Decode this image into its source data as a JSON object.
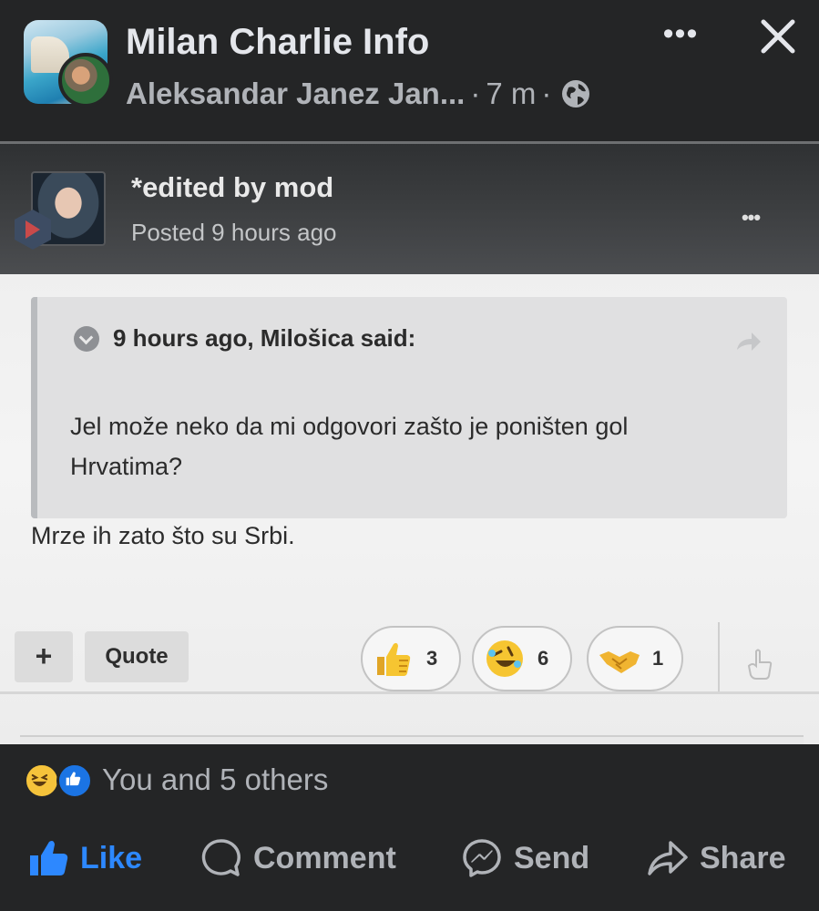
{
  "post": {
    "group_name": "Milan Charlie Info",
    "author": "Aleksandar Janez Jan...",
    "time": "7 m",
    "separator": "·",
    "more": "•••",
    "privacy_icon": "globe-icon"
  },
  "shared_image": {
    "title": "*edited by mod",
    "posted": "Posted 9 hours ago",
    "menu": "•••",
    "quote_header": "9 hours ago, Milošica said:",
    "quote_text": "Jel može neko da mi odgovori zašto je poništen gol Hrvatima?",
    "reply_text": "Mrze ih zato što su Srbi.",
    "plus_label": "+",
    "quote_button": "Quote",
    "reactions": [
      {
        "emoji": "thumbs-up",
        "count": "3"
      },
      {
        "emoji": "rofl",
        "count": "6"
      },
      {
        "emoji": "handshake",
        "count": "1"
      }
    ]
  },
  "summary": {
    "text": "You and 5 others"
  },
  "actions": {
    "like": "Like",
    "comment": "Comment",
    "send": "Send",
    "share": "Share"
  },
  "colors": {
    "background": "#242526",
    "accent": "#2d88ff",
    "text_secondary": "#b0b3b8"
  }
}
